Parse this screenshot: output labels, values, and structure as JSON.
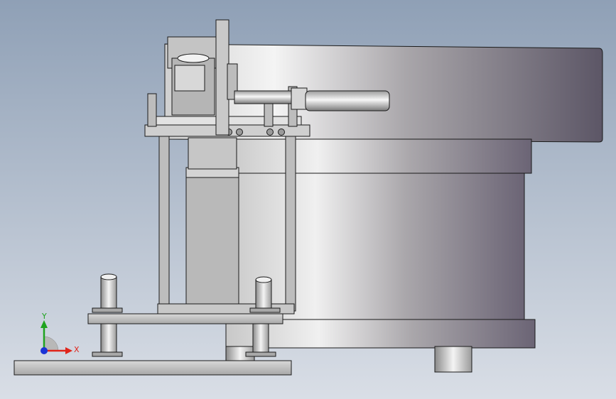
{
  "viewport": {
    "background_top": "#8fa0b6",
    "background_bottom": "#d9dee6"
  },
  "model": {
    "outline_color": "#1a1a1a",
    "shade_light": "#f2f2f2",
    "shade_mid": "#bdbdbd",
    "shade_dark": "#5a5566"
  },
  "triad": {
    "x_label": "X",
    "y_label": "Y",
    "x_color": "#e0251b",
    "y_color": "#1fa31f",
    "z_color": "#1a33d6"
  }
}
